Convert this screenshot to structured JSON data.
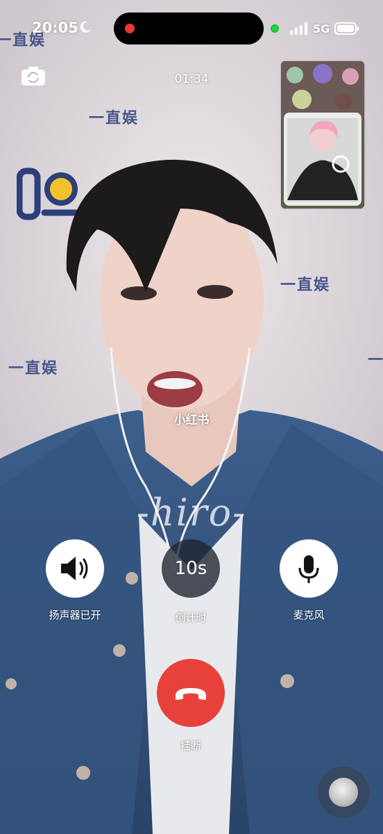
{
  "status_bar": {
    "time": "20:05",
    "network": "5G",
    "recording_color": "#e53935",
    "camera_indicator_color": "#2ecc40"
  },
  "call": {
    "duration": "01:34",
    "watermark": "小红书",
    "overlay_name": "-hiro-"
  },
  "background_text": {
    "brand": "一直娱",
    "logo_char": "娱"
  },
  "controls": {
    "speaker": {
      "label": "扬声器已开",
      "icon": "speaker-icon"
    },
    "timer": {
      "value": "10s",
      "label": "倒计时"
    },
    "mic": {
      "label": "麦克风",
      "icon": "microphone-icon"
    },
    "hangup": {
      "label": "挂断",
      "icon": "phone-hangup-icon",
      "color": "#e8413c"
    }
  },
  "top_bar": {
    "flip_icon": "camera-flip-icon"
  }
}
